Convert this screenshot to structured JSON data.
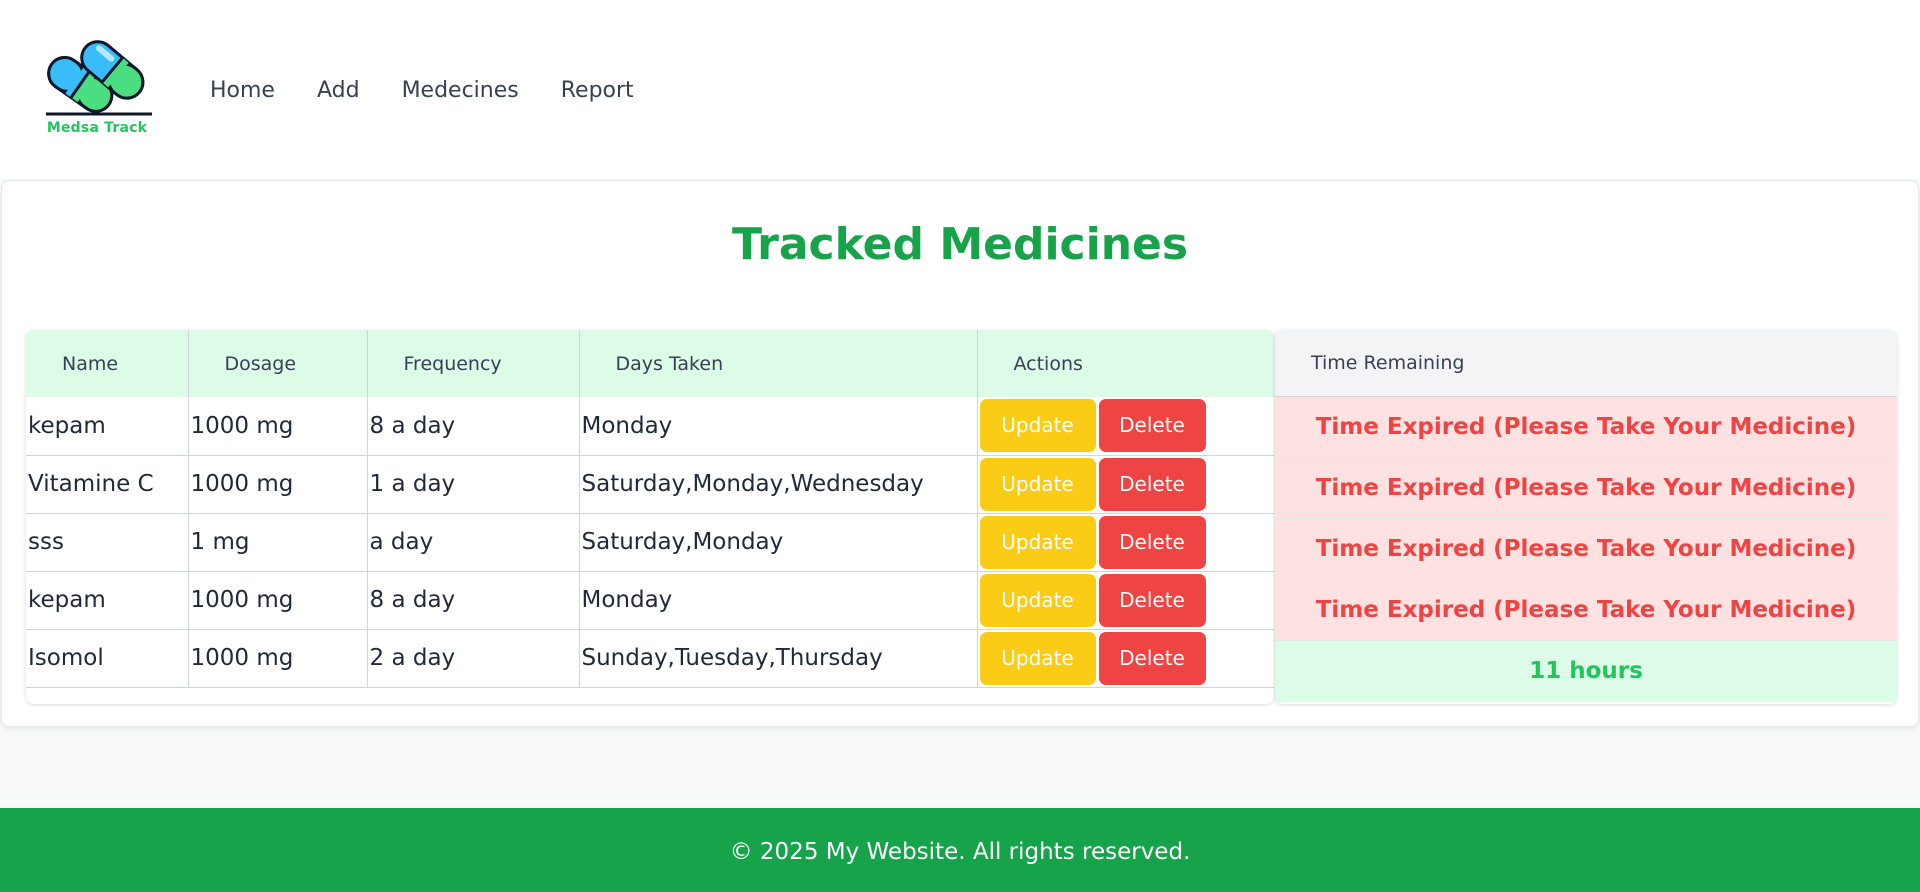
{
  "brand": {
    "name": "Medsa Track"
  },
  "nav": {
    "items": [
      "Home",
      "Add",
      "Medecines",
      "Report"
    ]
  },
  "main": {
    "title": "Tracked Medicines",
    "columns": [
      "Name",
      "Dosage",
      "Frequency",
      "Days Taken",
      "Actions"
    ],
    "update_label": "Update",
    "delete_label": "Delete",
    "rows": [
      {
        "name": "kepam",
        "dosage": "1000 mg",
        "frequency": "8 a day",
        "days": "Monday"
      },
      {
        "name": "Vitamine C",
        "dosage": "1000 mg",
        "frequency": "1 a day",
        "days": "Saturday,Monday,Wednesday"
      },
      {
        "name": "sss",
        "dosage": "1 mg",
        "frequency": "a day",
        "days": "Saturday,Monday"
      },
      {
        "name": "kepam",
        "dosage": "1000 mg",
        "frequency": "8 a day",
        "days": "Monday"
      },
      {
        "name": "Isomol",
        "dosage": "1000 mg",
        "frequency": "2 a day",
        "days": "Sunday,Tuesday,Thursday"
      }
    ]
  },
  "time": {
    "header": "Time Remaining",
    "rows": [
      "Time Expired (Please Take Your Medicine)",
      "Time Expired (Please Take Your Medicine)",
      "Time Expired (Please Take Your Medicine)",
      "Time Expired (Please Take Your Medicine)",
      "11 hours"
    ]
  },
  "footer": {
    "text": "© 2025 My Website. All rights reserved."
  },
  "colors": {
    "brand_green": "#16a34a",
    "update_yellow": "#facc15",
    "delete_red": "#ef4444",
    "expired_bg": "#fee2e2",
    "ok_bg": "#dcfce7"
  }
}
